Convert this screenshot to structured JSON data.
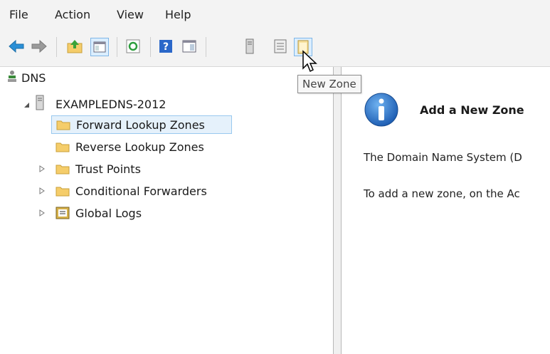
{
  "menu": {
    "file": "File",
    "action": "Action",
    "view": "View",
    "help": "Help"
  },
  "toolbar": {
    "icons": [
      "back-arrow-icon",
      "forward-arrow-icon",
      "up-folder-icon",
      "show-hide-tree-icon",
      "refresh-icon",
      "help-icon",
      "action-pane-icon",
      "server-icon",
      "list-icon",
      "new-zone-icon"
    ]
  },
  "tooltip": {
    "text": "New Zone"
  },
  "tree": {
    "root": "DNS",
    "server": "EXAMPLEDNS-2012",
    "items": [
      {
        "label": "Forward Lookup Zones"
      },
      {
        "label": "Reverse Lookup Zones"
      },
      {
        "label": "Trust Points"
      },
      {
        "label": "Conditional Forwarders"
      },
      {
        "label": "Global Logs"
      }
    ]
  },
  "detail": {
    "heading": "Add a New Zone",
    "para1": "The Domain Name System (D",
    "para2": "To add a new zone, on the Ac"
  },
  "colors": {
    "selection_bg": "#e5f1fb",
    "selection_border": "#99c9ef",
    "folder": "#f5cd6a",
    "info_blue": "#1f6ec4"
  }
}
